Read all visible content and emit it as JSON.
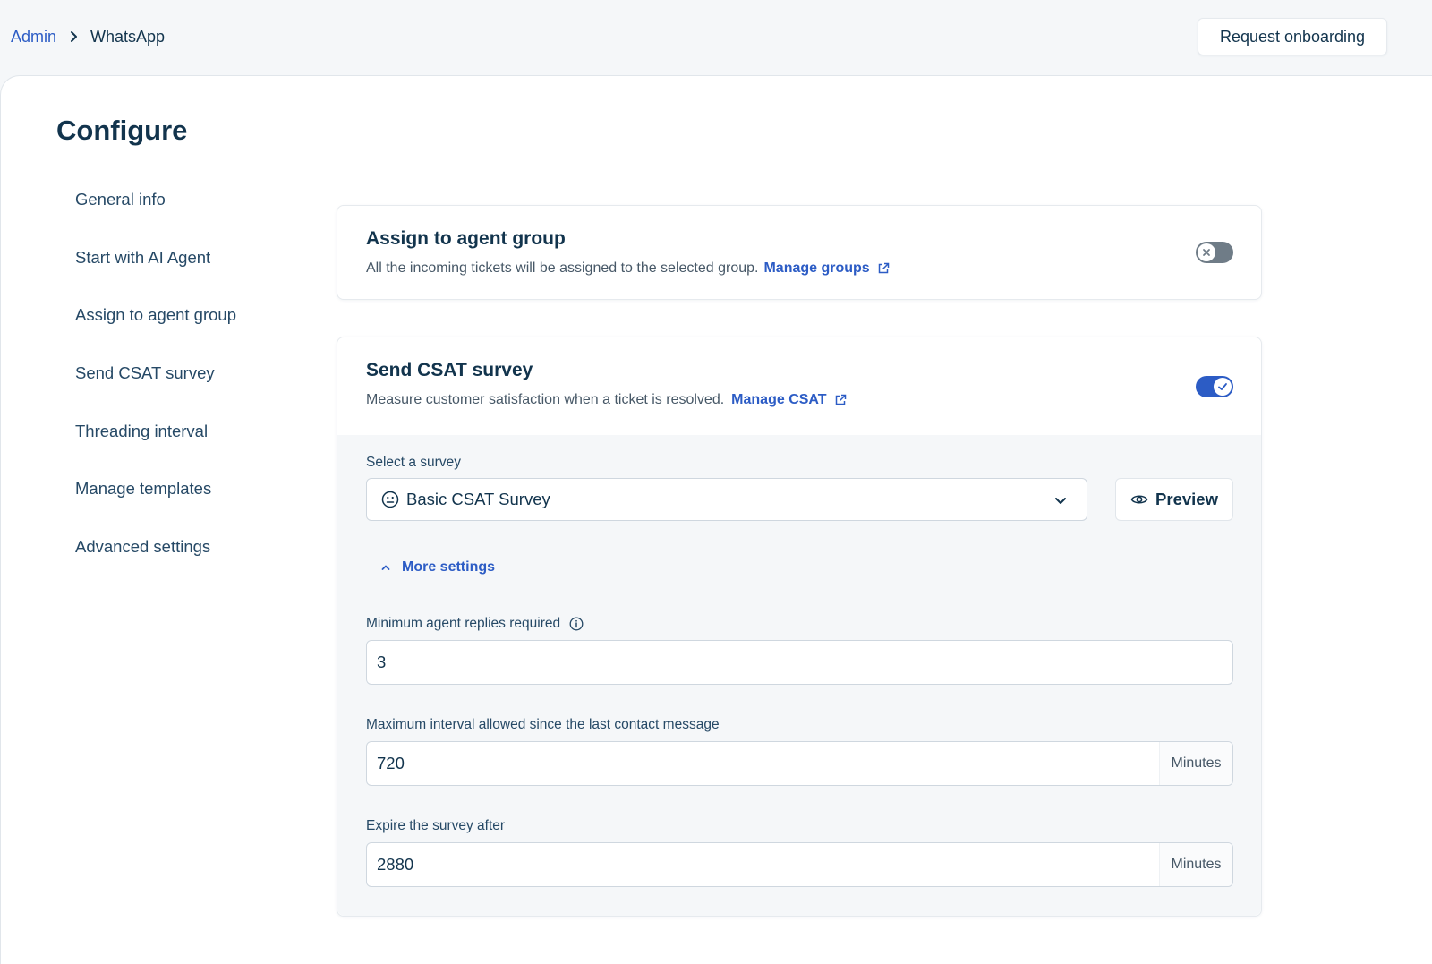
{
  "breadcrumb": {
    "parent": "Admin",
    "current": "WhatsApp"
  },
  "header": {
    "onboarding_button": "Request onboarding"
  },
  "page": {
    "title": "Configure"
  },
  "sidebar": {
    "items": [
      {
        "label": "General info"
      },
      {
        "label": "Start with AI Agent"
      },
      {
        "label": "Assign to agent group"
      },
      {
        "label": "Send CSAT survey"
      },
      {
        "label": "Threading interval"
      },
      {
        "label": "Manage templates"
      },
      {
        "label": "Advanced settings"
      }
    ]
  },
  "assign_group": {
    "title": "Assign to agent group",
    "description": "All the incoming tickets will be assigned to the selected group.",
    "link": "Manage groups",
    "enabled": false
  },
  "csat": {
    "title": "Send CSAT survey",
    "description": "Measure customer satisfaction when a ticket is resolved.",
    "link": "Manage CSAT",
    "enabled": true,
    "survey_label": "Select a survey",
    "survey_value": "Basic CSAT Survey",
    "preview_label": "Preview",
    "more_settings_label": "More settings",
    "min_replies": {
      "label": "Minimum agent replies required",
      "value": "3"
    },
    "max_interval": {
      "label": "Maximum interval allowed since the last contact message",
      "value": "720",
      "unit": "Minutes"
    },
    "expire": {
      "label": "Expire the survey after",
      "value": "2880",
      "unit": "Minutes"
    }
  },
  "colors": {
    "accent": "#2c5cc5",
    "text": "#12344d",
    "toggle_off": "#6f7c87"
  }
}
